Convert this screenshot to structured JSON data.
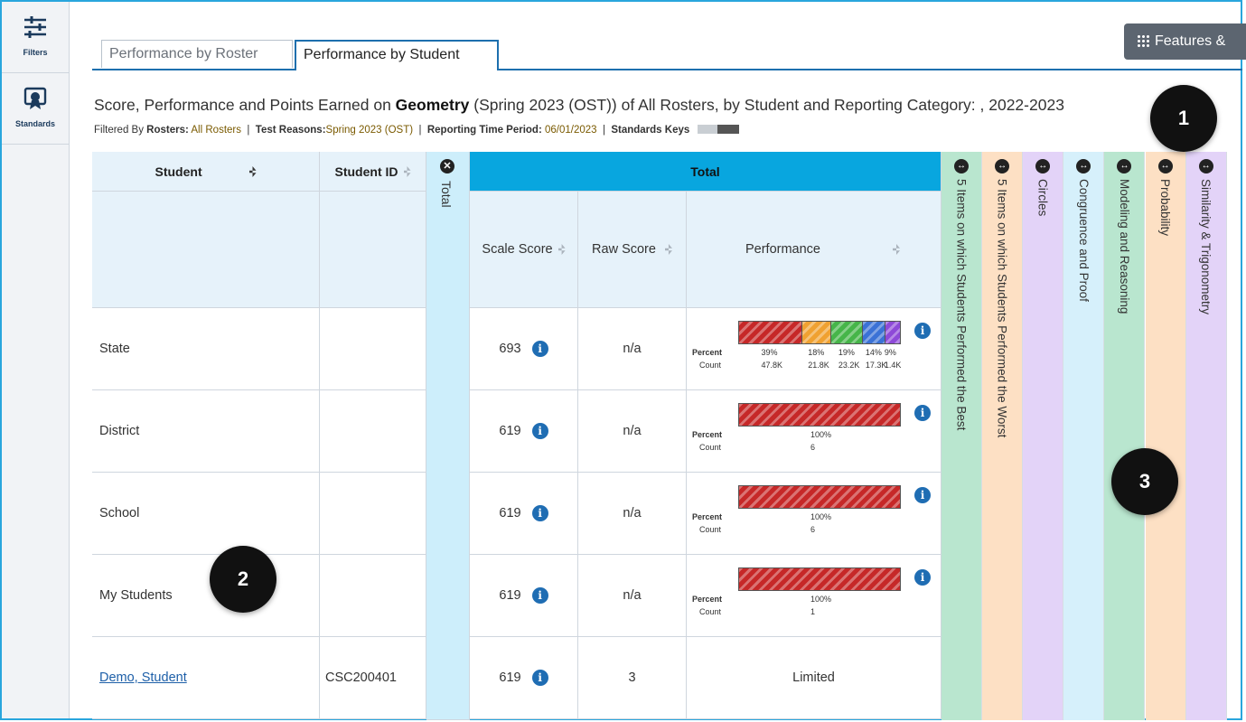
{
  "rail": {
    "filters_label": "Filters",
    "standards_label": "Standards"
  },
  "tabs": [
    {
      "label": "Performance by Roster",
      "active": false
    },
    {
      "label": "Performance by Student",
      "active": true
    }
  ],
  "features_button": "Features &",
  "title": {
    "prefix": "Score, Performance and Points Earned on ",
    "subject": "Geometry",
    "suffix": " (Spring 2023 (OST)) of All Rosters, by Student and Reporting Category: , 2022-2023"
  },
  "filters": {
    "lead": "Filtered By",
    "rosters_key": "Rosters:",
    "rosters_val": "All Rosters",
    "reasons_key": "Test Reasons:",
    "reasons_val": "Spring 2023 (OST)",
    "period_key": "Reporting Time Period:",
    "period_val": "06/01/2023",
    "keys_label": "Standards Keys",
    "sep": "|"
  },
  "badges": [
    "1",
    "2",
    "3"
  ],
  "table": {
    "col_student": "Student",
    "col_student_id": "Student ID",
    "col_total_collapsed": "Total",
    "col_total": "Total",
    "col_scale": "Scale Score",
    "col_raw": "Raw Score",
    "col_perf": "Performance",
    "percent_label": "Percent",
    "count_label": "Count",
    "rows": [
      {
        "student": "State",
        "student_id": "",
        "scale": "693",
        "raw": "n/a",
        "perf": {
          "segments": [
            39,
            18,
            19,
            14,
            9
          ],
          "percents": [
            "39%",
            "18%",
            "19%",
            "14%",
            "9%"
          ],
          "counts": [
            "47.8K",
            "21.8K",
            "23.2K",
            "17.3K",
            "1.4K"
          ]
        }
      },
      {
        "student": "District",
        "student_id": "",
        "scale": "619",
        "raw": "n/a",
        "perf": {
          "segments": [
            100
          ],
          "percents": [
            "100%"
          ],
          "counts": [
            "6"
          ]
        }
      },
      {
        "student": "School",
        "student_id": "",
        "scale": "619",
        "raw": "n/a",
        "perf": {
          "segments": [
            100
          ],
          "percents": [
            "100%"
          ],
          "counts": [
            "6"
          ]
        }
      },
      {
        "student": "My Students",
        "student_id": "",
        "scale": "619",
        "raw": "n/a",
        "perf": {
          "segments": [
            100
          ],
          "percents": [
            "100%"
          ],
          "counts": [
            "1"
          ]
        }
      },
      {
        "student": "Demo, Student",
        "student_id": "CSC200401",
        "scale": "619",
        "raw": "3",
        "perf_text": "Limited",
        "link": true
      }
    ],
    "categories": [
      {
        "label": "5 Items on which Students Performed the Best",
        "color": "#b9e6cf"
      },
      {
        "label": "5 Items on which Students Performed the Worst",
        "color": "#fde0c4"
      },
      {
        "label": "Circles",
        "color": "#e3d3f8"
      },
      {
        "label": "Congruence and Proof",
        "color": "#d6f0fb"
      },
      {
        "label": "Modeling and Reasoning",
        "color": "#b9e6cf"
      },
      {
        "label": "Probability",
        "color": "#fde0c4"
      },
      {
        "label": "Similarity & Trigonometry",
        "color": "#e3d3f8"
      }
    ]
  },
  "colors": {
    "accent": "#1d6fae",
    "total_header": "#08a6df",
    "perf_segments": [
      "#c62828",
      "#f0a131",
      "#46b549",
      "#3b72d6",
      "#8e49d8"
    ]
  }
}
